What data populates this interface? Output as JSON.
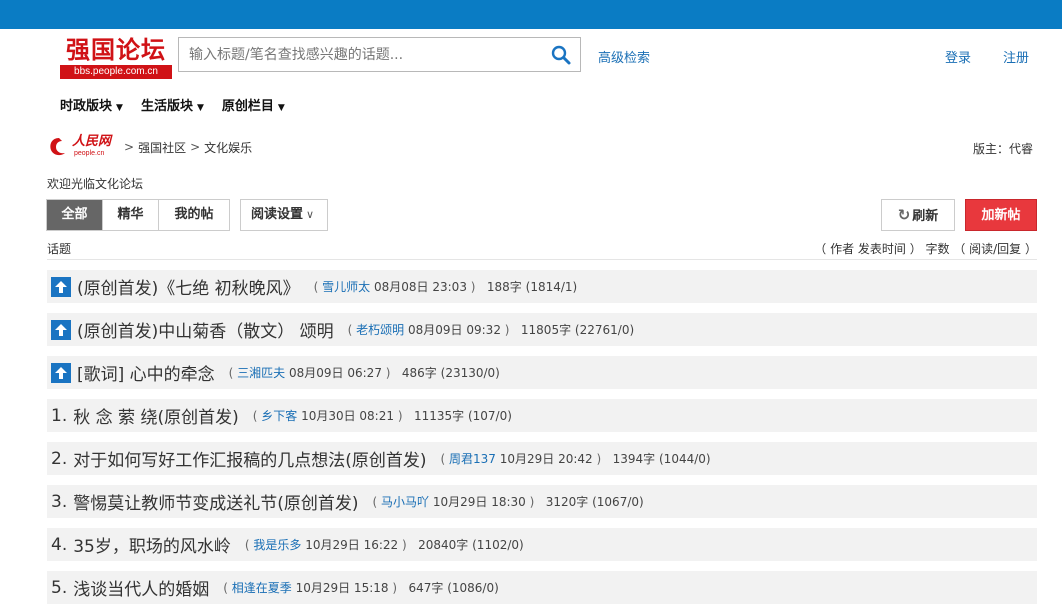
{
  "header": {
    "logo_title": "强国论坛",
    "logo_url": "bbs.people.com.cn",
    "search_placeholder": "输入标题/笔名查找感兴趣的话题...",
    "advanced_search": "高级检索",
    "login": "登录",
    "register": "注册"
  },
  "nav": [
    {
      "label": "时政版块"
    },
    {
      "label": "生活版块"
    },
    {
      "label": "原创栏目"
    }
  ],
  "breadcrumb": {
    "logo_text": "人民网",
    "logo_sub": "people.cn",
    "items": [
      "强国社区",
      "文化娱乐"
    ]
  },
  "moderator": "版主：代睿",
  "welcome": "欢迎光临文化论坛",
  "tabs": [
    "全部",
    "精华",
    "我的帖"
  ],
  "read_settings": "阅读设置",
  "refresh": "刷新",
  "new_post": "加新帖",
  "list_header": {
    "left": "话题",
    "right": "（ 作者  发表时间 ） 字数 （ 阅读/回复 ）"
  },
  "colors": {
    "topbar": "#0a7cc4",
    "brand_red": "#d01216",
    "new_post": "#e8383d",
    "link": "#1a6fb5"
  },
  "topics": [
    {
      "pinned": true,
      "rank": "",
      "title": "(原创首发)《七绝 初秋晚风》",
      "author": "雪儿师太",
      "time": "08月08日 23:03",
      "words": "188字",
      "stats": "(1814/1)"
    },
    {
      "pinned": true,
      "rank": "",
      "title": "(原创首发)中山菊香（散文） 颂明",
      "author": "老朽颂明",
      "time": "08月09日 09:32",
      "words": "11805字",
      "stats": "(22761/0)"
    },
    {
      "pinned": true,
      "rank": "",
      "title": "[歌词] 心中的牵念",
      "author": "三湘匹夫",
      "time": "08月09日 06:27",
      "words": "486字",
      "stats": "(23130/0)"
    },
    {
      "pinned": false,
      "rank": "1.",
      "title": "秋 念 萦 绕(原创首发)",
      "author": "乡下客",
      "time": "10月30日 08:21",
      "words": "11135字",
      "stats": "(107/0)"
    },
    {
      "pinned": false,
      "rank": "2.",
      "title": "对于如何写好工作汇报稿的几点想法(原创首发)",
      "author": "周君137",
      "time": "10月29日 20:42",
      "words": "1394字",
      "stats": "(1044/0)"
    },
    {
      "pinned": false,
      "rank": "3.",
      "title": "警惕莫让教师节变成送礼节(原创首发)",
      "author": "马小马吖",
      "time": "10月29日 18:30",
      "words": "3120字",
      "stats": "(1067/0)"
    },
    {
      "pinned": false,
      "rank": "4.",
      "title": "35岁，职场的风水岭",
      "author": "我是乐多",
      "time": "10月29日 16:22",
      "words": "20840字",
      "stats": "(1102/0)"
    },
    {
      "pinned": false,
      "rank": "5.",
      "title": "浅谈当代人的婚姻",
      "author": "相逢在夏季",
      "time": "10月29日 15:18",
      "words": "647字",
      "stats": "(1086/0)"
    }
  ]
}
